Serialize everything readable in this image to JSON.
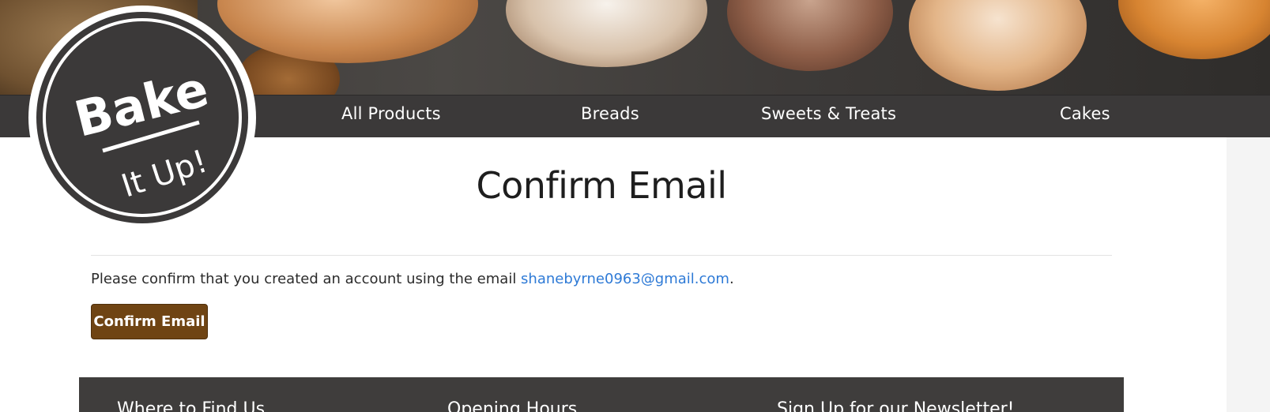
{
  "brand": {
    "logo_line1": "Bake",
    "logo_line2": "It Up!"
  },
  "nav": {
    "items": [
      {
        "label": "All Products"
      },
      {
        "label": "Breads"
      },
      {
        "label": "Sweets & Treats"
      },
      {
        "label": "Cakes"
      }
    ]
  },
  "main": {
    "title": "Confirm Email",
    "message_prefix": "Please confirm that you created an account using the email ",
    "email": "shanebyrne0963@gmail.com",
    "message_suffix": ".",
    "confirm_button": "Confirm Email"
  },
  "footer": {
    "headings": [
      "Where to Find Us",
      "Opening Hours",
      "Sign Up for our Newsletter!"
    ]
  },
  "colors": {
    "nav_bg": "#3b3939",
    "button_bg": "#6f4413",
    "link": "#2e7ad6",
    "footer_bg": "#3f3d3c"
  }
}
